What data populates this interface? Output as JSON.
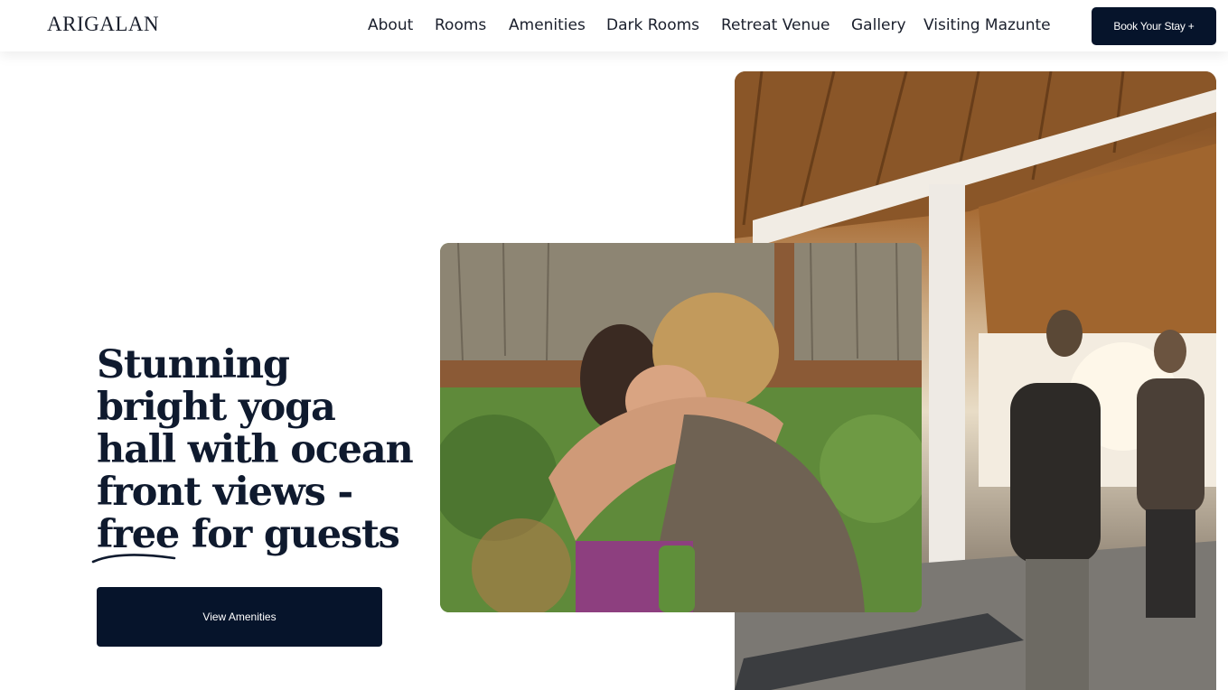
{
  "header": {
    "logo": "ARIGALAN",
    "nav": [
      {
        "label": "About"
      },
      {
        "label": "Rooms"
      },
      {
        "label": "Amenities"
      },
      {
        "label": "Dark Rooms"
      },
      {
        "label": "Retreat Venue"
      },
      {
        "label": "Gallery"
      },
      {
        "label": "Visiting Mazunte"
      }
    ],
    "book_button": "Book Your Stay +"
  },
  "hero": {
    "title_lines": [
      "Stunning",
      "bright yoga",
      "hall with ocean",
      "front views -"
    ],
    "title_underlined_word": "free",
    "title_tail": " for guests",
    "button": "View Amenities"
  },
  "colors": {
    "primary": "#06142b",
    "text": "#0f1a2e",
    "background": "#ffffff"
  }
}
